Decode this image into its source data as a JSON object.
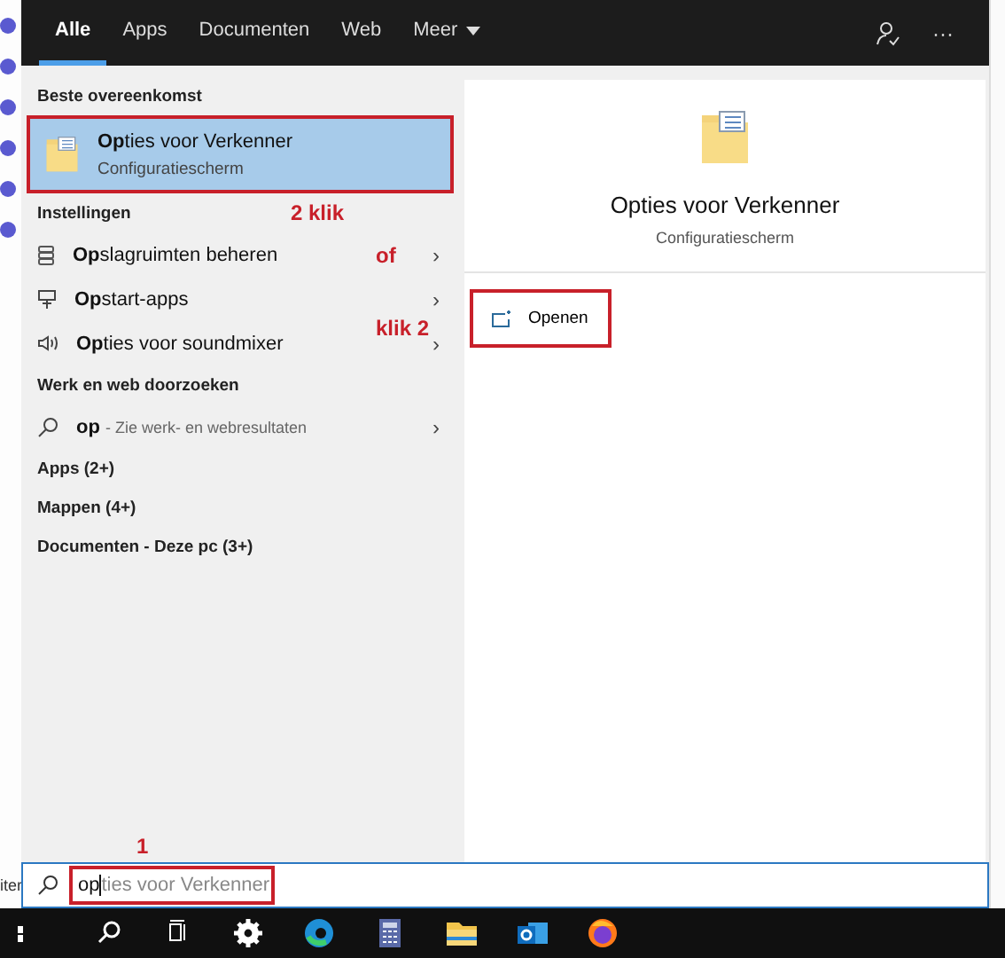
{
  "tabs": [
    {
      "label": "Alle",
      "selected": true
    },
    {
      "label": "Apps",
      "selected": false
    },
    {
      "label": "Documenten",
      "selected": false
    },
    {
      "label": "Web",
      "selected": false
    },
    {
      "label": "Meer",
      "selected": false,
      "dropdown": true
    }
  ],
  "header_more": "···",
  "results": [
    {
      "kind": "heading",
      "label": "Beste overeenkomst"
    },
    {
      "kind": "best",
      "title": "**Op**ties voor Verkenner",
      "subtitle": "Configuratiescherm",
      "selected": true,
      "annotated": true
    },
    {
      "kind": "heading",
      "label": "Instellingen",
      "note": "2 klik"
    },
    {
      "kind": "setting",
      "label": "**Op**slagruimten beheren",
      "note": "of",
      "chevron": "›"
    },
    {
      "kind": "setting",
      "label": "**Op**start-apps",
      "chevron": "›"
    },
    {
      "kind": "setting",
      "label": "**Op**ties voor soundmixer",
      "note": "klik 2",
      "chevron": "›"
    },
    {
      "kind": "heading",
      "label": "Werk en web doorzoeken"
    },
    {
      "kind": "web",
      "query": "op",
      "hint": "- Zie werk- en webresultaten",
      "chevron": "›"
    },
    {
      "kind": "heading",
      "label": "Apps (2+)"
    },
    {
      "kind": "heading",
      "label": "Mappen (4+)"
    },
    {
      "kind": "heading",
      "label": "Documenten - Deze pc (3+)"
    }
  ],
  "preview": {
    "title": "Opties voor Verkenner",
    "subtitle": "Configuratiescherm",
    "actions": [
      {
        "label": "Openen",
        "annotated": true
      }
    ]
  },
  "search": {
    "value": "op",
    "suggestion": "ties voor Verkenner",
    "note": "1",
    "annotated": true
  },
  "desktop_label": "iter"
}
